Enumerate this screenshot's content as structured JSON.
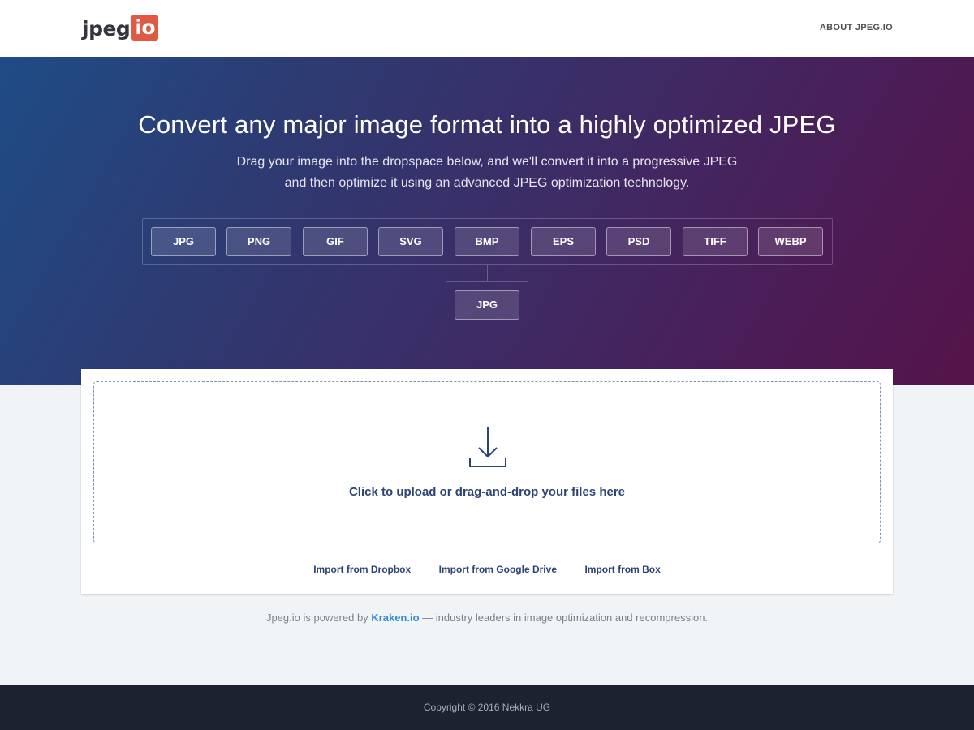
{
  "header": {
    "logo_text": "jpeg",
    "logo_box": "io",
    "about_label": "ABOUT JPEG.IO"
  },
  "hero": {
    "title": "Convert any major image format into a highly optimized JPEG",
    "subtitle_line1": "Drag your image into the dropspace below, and we'll convert it into a progressive JPEG",
    "subtitle_line2": "and then optimize it using an advanced JPEG optimization technology.",
    "input_formats": [
      "JPG",
      "PNG",
      "GIF",
      "SVG",
      "BMP",
      "EPS",
      "PSD",
      "TIFF",
      "WEBP"
    ],
    "output_format": "JPG"
  },
  "upload": {
    "icon": "download-icon",
    "prompt": "Click to upload or drag-and-drop your files here",
    "imports": {
      "dropbox": "Import from Dropbox",
      "google_drive": "Import from Google Drive",
      "box": "Import from Box"
    }
  },
  "powered": {
    "prefix": "Jpeg.io is powered by ",
    "link": "Kraken.io",
    "suffix": " — industry leaders in image optimization and recompression."
  },
  "footer": {
    "copyright": "Copyright © 2016 Nekkra UG"
  },
  "colors": {
    "logo_accent": "#e05a43",
    "link_blue": "#3b8ad9",
    "navy_text": "#2c4472",
    "footer_bg": "#1c2230"
  }
}
